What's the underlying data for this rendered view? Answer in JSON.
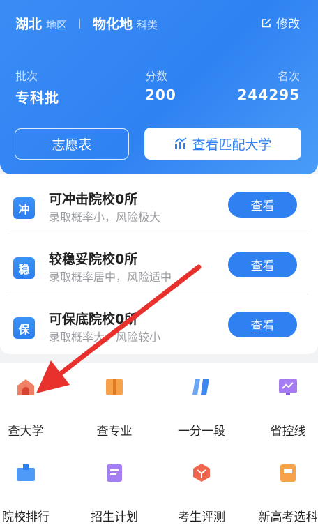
{
  "header": {
    "province": "湖北",
    "province_label": "地区",
    "subjects": "物化地",
    "subjects_label": "科类",
    "edit_label": "修改",
    "stats": {
      "batch_label": "批次",
      "score_label": "分数",
      "rank_label": "名次",
      "batch": "专科批",
      "score": "200",
      "rank": "244295"
    },
    "wish_button": "志愿表",
    "match_button": "查看匹配大学"
  },
  "risk_list": [
    {
      "badge": "冲",
      "title": "可冲击院校0所",
      "desc": "录取概率小，风险极大",
      "button": "查看"
    },
    {
      "badge": "稳",
      "title": "较稳妥院校0所",
      "desc": "录取概率居中，风险适中",
      "button": "查看"
    },
    {
      "badge": "保",
      "title": "可保底院校0所",
      "desc": "录取概率大，风险较小",
      "button": "查看"
    }
  ],
  "tools": [
    {
      "label": "查大学",
      "icon": "university-icon"
    },
    {
      "label": "查专业",
      "icon": "book-icon"
    },
    {
      "label": "一分一段",
      "icon": "segment-icon"
    },
    {
      "label": "省控线",
      "icon": "chart-icon"
    },
    {
      "label": "院校排行",
      "icon": "ranking-icon"
    },
    {
      "label": "招生计划",
      "icon": "plan-icon"
    },
    {
      "label": "考生评测",
      "icon": "assessment-icon"
    },
    {
      "label": "新高考选科",
      "icon": "subject-select-icon"
    }
  ],
  "colors": {
    "primary": "#2f80f1",
    "arrow": "#e8312c"
  }
}
